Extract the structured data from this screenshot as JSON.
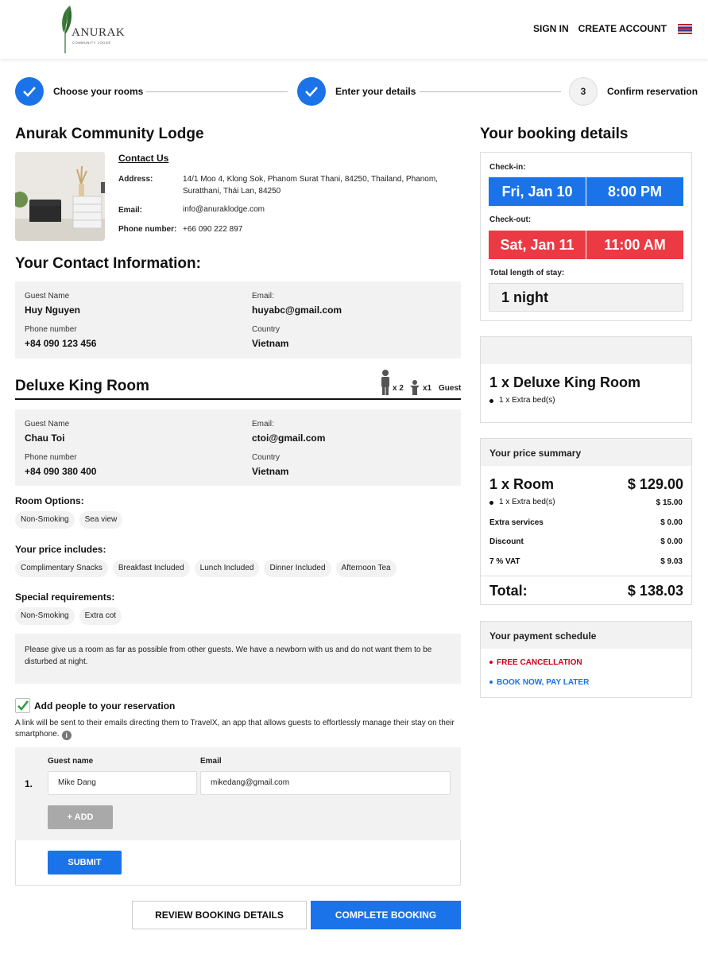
{
  "header": {
    "logo_text": "ANURAK",
    "logo_sub": "COMMUNITY LODGE",
    "sign_in": "SIGN IN",
    "create_account": "CREATE ACCOUNT"
  },
  "steps": [
    {
      "label": "Choose your rooms",
      "state": "done"
    },
    {
      "label": "Enter your details",
      "state": "done"
    },
    {
      "label": "Confirm reservation",
      "state": "todo",
      "number": "3"
    }
  ],
  "lodge": {
    "name": "Anurak Community Lodge",
    "contact_title": "Contact Us",
    "address_label": "Address:",
    "address_value": "14/1 Moo 4, Klong Sok, Phanom Surat Thani, 84250, Thailand, Phanom, Suratthani, Thái Lan, 84250",
    "email_label": "Email:",
    "email_value": "info@anuraklodge.com",
    "phone_label": "Phone number:",
    "phone_value": "+66 090 222 897"
  },
  "contact_info": {
    "title": "Your Contact Information:",
    "guest_name_label": "Guest Name",
    "guest_name": "Huy Nguyen",
    "email_label": "Email:",
    "email": "huyabc@gmail.com",
    "phone_label": "Phone number",
    "phone": "+84 090 123 456",
    "country_label": "Country",
    "country": "Vietnam"
  },
  "room": {
    "title": "Deluxe King Room",
    "adults": "x 2",
    "children": "x1",
    "guest_label": "Guest",
    "guest_name_label": "Guest Name",
    "guest_name": "Chau Toi",
    "email_label": "Email:",
    "email": "ctoi@gmail.com",
    "phone_label": "Phone number",
    "phone": "+84 090 380 400",
    "country_label": "Country",
    "country": "Vietnam",
    "options_title": "Room Options:",
    "options": [
      "Non-Smoking",
      "Sea view"
    ],
    "includes_title": "Your price includes:",
    "includes": [
      "Complimentary Snacks",
      "Breakfast Included",
      "Lunch Included",
      "Dinner Included",
      "Afternoon Tea"
    ],
    "special_title": "Special requirements:",
    "special": [
      "Non-Smoking",
      "Extra cot"
    ],
    "note": "Please give us a room as far as possible from other guests. We have a newborn with us and do not want them to be disturbed at night."
  },
  "add_people": {
    "checked": true,
    "title": "Add people to your reservation",
    "desc": "A link will be sent to their emails directing them to TravelX, an app that allows guests to effortlessly manage their stay on their smartphone.",
    "col_name": "Guest name",
    "col_email": "Email",
    "row_index": "1.",
    "row_name": "Mike Dang",
    "row_email": "mikedang@gmail.com",
    "add_label": "+ ADD",
    "submit_label": "SUBMIT"
  },
  "footer_buttons": {
    "review": "REVIEW BOOKING DETAILS",
    "complete": "COMPLETE BOOKING"
  },
  "booking": {
    "title": "Your booking details",
    "checkin_label": "Check-in:",
    "checkin_date": "Fri, Jan 10",
    "checkin_time": "8:00 PM",
    "checkout_label": "Check-out:",
    "checkout_date": "Sat, Jan 11",
    "checkout_time": "11:00 AM",
    "length_label": "Total length of stay:",
    "length_value": "1 night",
    "room_summary": "1 x Deluxe King Room",
    "room_extra": "1 x Extra bed(s)"
  },
  "price": {
    "title": "Your price summary",
    "room_label": "1 x Room",
    "room_value": "$ 129.00",
    "extra_bed_label": "1 x Extra bed(s)",
    "extra_bed_value": "$ 15.00",
    "services_label": "Extra services",
    "services_value": "$ 0.00",
    "discount_label": "Discount",
    "discount_value": "$ 0.00",
    "vat_label": "7 % VAT",
    "vat_value": "$ 9.03",
    "total_label": "Total:",
    "total_value": "$ 138.03"
  },
  "schedule": {
    "title": "Your payment schedule",
    "free_cancel": "FREE CANCELLATION",
    "book_now": "BOOK NOW, PAY LATER"
  },
  "colors": {
    "primary": "#1a73e8",
    "red": "#ec3a44",
    "checkin_blue": "#1a73e8",
    "free_cancel": "#d0021b",
    "book_now": "#1a73e8"
  }
}
